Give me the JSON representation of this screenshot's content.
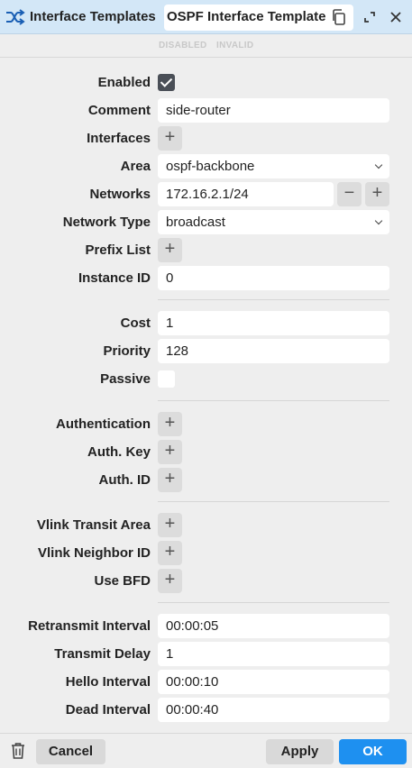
{
  "window": {
    "title": "Interface Templates",
    "tab_label": "OSPF Interface Template",
    "icon": "shuffle-icon"
  },
  "flags": {
    "disabled": "DISABLED",
    "invalid": "INVALID"
  },
  "form": {
    "enabled": {
      "label": "Enabled",
      "checked": true
    },
    "comment": {
      "label": "Comment",
      "value": "side-router"
    },
    "interfaces": {
      "label": "Interfaces"
    },
    "area": {
      "label": "Area",
      "value": "ospf-backbone"
    },
    "networks": {
      "label": "Networks",
      "value": "172.16.2.1/24"
    },
    "network_type": {
      "label": "Network Type",
      "value": "broadcast"
    },
    "prefix_list": {
      "label": "Prefix List"
    },
    "instance_id": {
      "label": "Instance ID",
      "value": "0"
    },
    "cost": {
      "label": "Cost",
      "value": "1"
    },
    "priority": {
      "label": "Priority",
      "value": "128"
    },
    "passive": {
      "label": "Passive",
      "checked": false
    },
    "authentication": {
      "label": "Authentication"
    },
    "auth_key": {
      "label": "Auth. Key"
    },
    "auth_id": {
      "label": "Auth. ID"
    },
    "vlink_transit_area": {
      "label": "Vlink Transit Area"
    },
    "vlink_neighbor_id": {
      "label": "Vlink Neighbor ID"
    },
    "use_bfd": {
      "label": "Use BFD"
    },
    "retransmit_interval": {
      "label": "Retransmit Interval",
      "value": "00:00:05"
    },
    "transmit_delay": {
      "label": "Transmit Delay",
      "value": "1"
    },
    "hello_interval": {
      "label": "Hello Interval",
      "value": "00:00:10"
    },
    "dead_interval": {
      "label": "Dead Interval",
      "value": "00:00:40"
    }
  },
  "footer": {
    "cancel": "Cancel",
    "apply": "Apply",
    "ok": "OK"
  },
  "glyphs": {
    "plus": "+",
    "minus": "−"
  },
  "colors": {
    "titlebar": "#d3e7f7",
    "accent": "#1e90f0",
    "background": "#eeeeee"
  }
}
